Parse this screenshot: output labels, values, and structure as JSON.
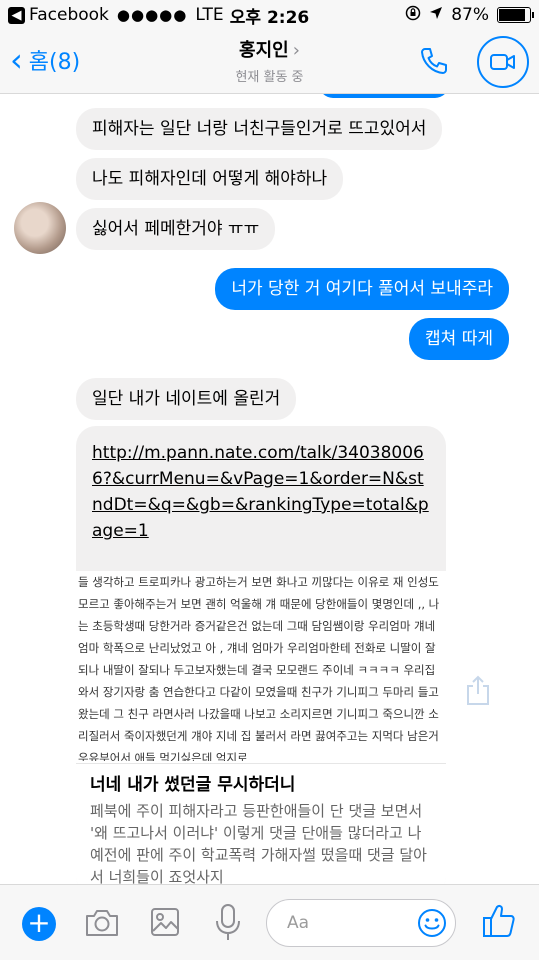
{
  "status_bar": {
    "back_app": "Facebook",
    "signal": "●●●●●",
    "carrier": "LTE",
    "time": "오후 2:26",
    "battery": "87%",
    "battery_level": 0.87
  },
  "header": {
    "back_label": "홈(8)",
    "contact_name": "홍지인",
    "contact_status": "현재 활동 중"
  },
  "messages": [
    {
      "side": "in",
      "text": "피해자는 일단 너랑 너친구들인거로 뜨고있어서"
    },
    {
      "side": "in",
      "text": "나도 피해자인데 어떻게 해야하나"
    },
    {
      "side": "in",
      "text": "싫어서 페메한거야 ㅠㅠ"
    },
    {
      "side": "out",
      "text": "너가 당한 거 여기다 풀어서 보내주라"
    },
    {
      "side": "out",
      "text": "캡쳐 따게"
    },
    {
      "side": "in",
      "text": "일단 내가 네이트에 올린거"
    }
  ],
  "link_card": {
    "url": "http://m.pann.nate.com/talk/340380066?&currMenu=&vPage=1&order=N&stndDt=&q=&gb=&rankingType=total&page=1",
    "image_text": "들 생각하고 트로피카나 광고하는거 보면 화나고 끼많다는 이유로 재 인성도 모르고 좋아해주는거 보면 괜히 억울해 걔 때문에 당한애들이 몇명인데 ,, 나는 초등학생때 당한거라 증거같은건 없는데 그때 담임쌤이랑 우리엄마 걔네엄마 학폭으로 난리났었고 아 , 걔네 엄마가 우리엄마한테 전화로 니딸이 잘되나 내딸이 잘되나 두고보자했는데 결국 모모랜드 주이네 ㅋㅋㅋㅋ 우리집와서 장기자랑 춤 연습한다고 다같이 모였을때 친구가 기니피그 두마리 들고왔는데 그 친구 라면사러 나갔을때 나보고 소리지르면 기니피그 죽으니깐 소리질러서 죽이자했던게 걔야 지네 집 불러서 라면 끓여주고는 지먹다 남은거 우유부어서 애들 먹기싫은데 억지로",
    "article_title": "너네 내가 썼던글 무시하더니",
    "article_body": "페북에 주이 피해자라고 등판한애들이 단 댓글 보면서 '왜 뜨고나서 이러냐' 이렇게 댓글 단애들 많더라고 나 예전에 판에 주이 학교폭력 가해자썰 떴을때 댓글 달아서 너희들이 죠엇사지"
  },
  "composer": {
    "placeholder": "Aa"
  },
  "colors": {
    "accent": "#0084ff",
    "incoming_bubble": "#f1f0f0",
    "bar_background": "#f7f7f7"
  },
  "icons": [
    "plus-icon",
    "camera-icon",
    "photo-icon",
    "microphone-icon",
    "emoji-icon",
    "thumbs-up-icon",
    "phone-icon",
    "video-icon",
    "share-icon"
  ]
}
